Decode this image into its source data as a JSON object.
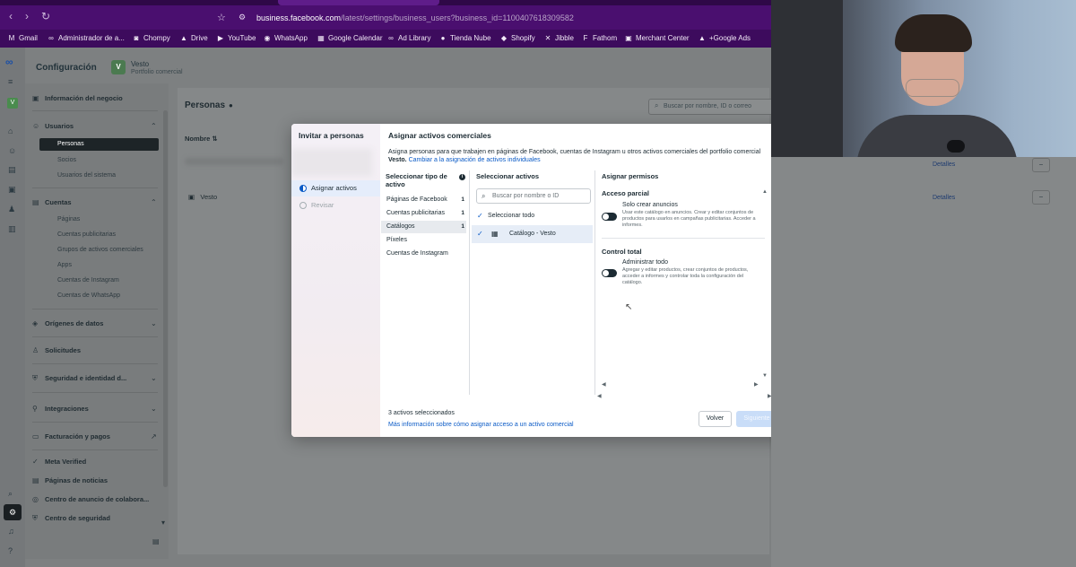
{
  "browser": {
    "url_domain": "business.facebook.com",
    "url_path": "/latest/settings/business_users?business_id=1100407618309582",
    "bookmarks": [
      {
        "icon": "gmail-icon",
        "glyph": "M",
        "label": "Gmail"
      },
      {
        "icon": "meta-icon",
        "glyph": "∞",
        "label": "Administrador de a..."
      },
      {
        "icon": "chompy-icon",
        "glyph": "◙",
        "label": "Chompy"
      },
      {
        "icon": "drive-icon",
        "glyph": "▲",
        "label": "Drive"
      },
      {
        "icon": "youtube-icon",
        "glyph": "▶",
        "label": "YouTube"
      },
      {
        "icon": "whatsapp-icon",
        "glyph": "◉",
        "label": "WhatsApp"
      },
      {
        "icon": "google-calendar-icon",
        "glyph": "▦",
        "label": "Google Calendar"
      },
      {
        "icon": "meta-icon",
        "glyph": "∞",
        "label": "Ad Library"
      },
      {
        "icon": "tienda-nube-icon",
        "glyph": "●",
        "label": "Tienda Nube"
      },
      {
        "icon": "shopify-icon",
        "glyph": "◆",
        "label": "Shopify"
      },
      {
        "icon": "jibble-icon",
        "glyph": "✕",
        "label": "Jibble"
      },
      {
        "icon": "fathom-icon",
        "glyph": "F",
        "label": "Fathom"
      },
      {
        "icon": "merchant-center-icon",
        "glyph": "▣",
        "label": "Merchant Center"
      },
      {
        "icon": "google-ads-icon",
        "glyph": "▲",
        "label": "+Google Ads"
      }
    ]
  },
  "app": {
    "config_title": "Configuración",
    "business_initial": "V",
    "business_name": "Vesto",
    "business_subtitle": "Portfolio comercial"
  },
  "leftnav": {
    "info": "Información del negocio",
    "users": "Usuarios",
    "users_sub": [
      "Personas",
      "Socios",
      "Usuarios del sistema"
    ],
    "accounts": "Cuentas",
    "accounts_sub": [
      "Páginas",
      "Cuentas publicitarias",
      "Grupos de activos comerciales",
      "Apps",
      "Cuentas de Instagram",
      "Cuentas de WhatsApp"
    ],
    "data_sources": "Orígenes de datos",
    "requests": "Solicitudes",
    "security": "Seguridad e identidad d...",
    "integrations": "Integraciones",
    "billing": "Facturación y pagos",
    "meta_verified": "Meta Verified",
    "news_pages": "Páginas de noticias",
    "collab_center": "Centro de anuncio de colabora...",
    "security_center": "Centro de seguridad"
  },
  "content": {
    "title": "Personas",
    "search_placeholder": "Buscar por nombre, ID o correo",
    "col_name": "Nombre",
    "row_name": "Vesto",
    "details_label": "Detalles"
  },
  "modal": {
    "wizard_title": "Invitar a personas",
    "steps": [
      "Asignar activos",
      "Revisar"
    ],
    "heading": "Asignar activos comerciales",
    "desc": "Asigna personas para que trabajen en páginas de Facebook, cuentas de Instagram u otros activos comerciales del portfolio comercial",
    "desc_bold": "Vesto.",
    "desc_link": "Cambiar a la asignación de activos individuales",
    "col1_head": "Seleccionar tipo de activo",
    "asset_types": [
      {
        "label": "Páginas de Facebook",
        "count": "1"
      },
      {
        "label": "Cuentas publicitarias",
        "count": "1"
      },
      {
        "label": "Catálogos",
        "count": "1"
      },
      {
        "label": "Píxeles",
        "count": ""
      },
      {
        "label": "Cuentas de Instagram",
        "count": ""
      }
    ],
    "col2_head": "Seleccionar activos",
    "search_placeholder": "Buscar por nombre o ID",
    "select_all": "Seleccionar todo",
    "asset_item": "Catálogo - Vesto",
    "col3_head": "Asignar permisos",
    "partial": {
      "title": "Acceso parcial",
      "perm_title": "Solo crear anuncios",
      "perm_desc": "Usar este catálogo en anuncios. Crear y editar conjuntos de productos para usarlos en campañas publicitarias. Acceder a informes."
    },
    "full": {
      "title": "Control total",
      "perm_title": "Administrar todo",
      "perm_desc": "Agregar y editar productos, crear conjuntos de productos, acceder a informes y controlar toda la configuración del catálogo."
    },
    "footer_count": "3 activos seleccionados",
    "footer_link": "Más información sobre cómo asignar acceso a un activo comercial",
    "btn_back": "Volver",
    "btn_next": "Siguiente"
  }
}
